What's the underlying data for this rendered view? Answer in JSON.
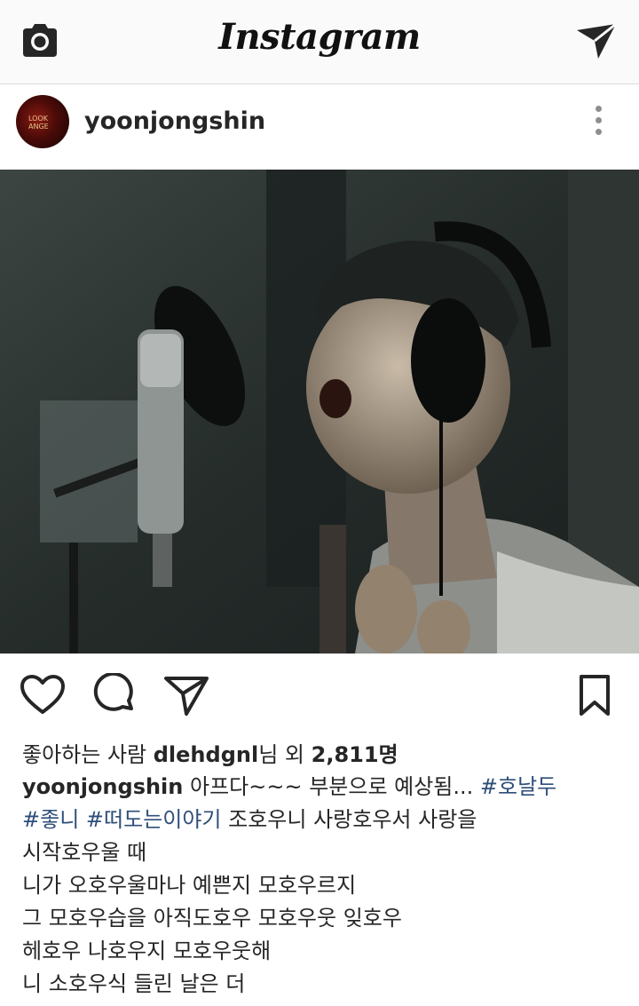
{
  "app": {
    "logo": "Instagram"
  },
  "post": {
    "username": "yoonjongshin",
    "avatar_label": "LOOK ANGE",
    "likes": {
      "prefix": "좋아하는 사람 ",
      "user": "dlehdgnl",
      "middle": "님 외 ",
      "count": "2,811",
      "suffix": "명"
    },
    "caption": {
      "text1": " 아프다~~~ 부분으로 예상됨... ",
      "tag1": "#호날두",
      "tag2": "#좋니",
      "tag3": "#떠도는이야기",
      "text2": "  조호우니 사랑호우서 사랑을",
      "lines": [
        "시작호우울 때",
        "니가 오호우울마나 예쁜지 모호우르지",
        "그 모호우습을 아직도호우 모호우웃 잊호우",
        "헤호우 나호우지 모호우웃해",
        "니 소호우식 들린 날은 더"
      ]
    }
  },
  "icons": {
    "camera": "camera-icon",
    "direct": "direct-send-icon",
    "more": "more-options-icon",
    "like": "heart-icon",
    "comment": "comment-icon",
    "share": "share-icon",
    "save": "bookmark-icon"
  }
}
